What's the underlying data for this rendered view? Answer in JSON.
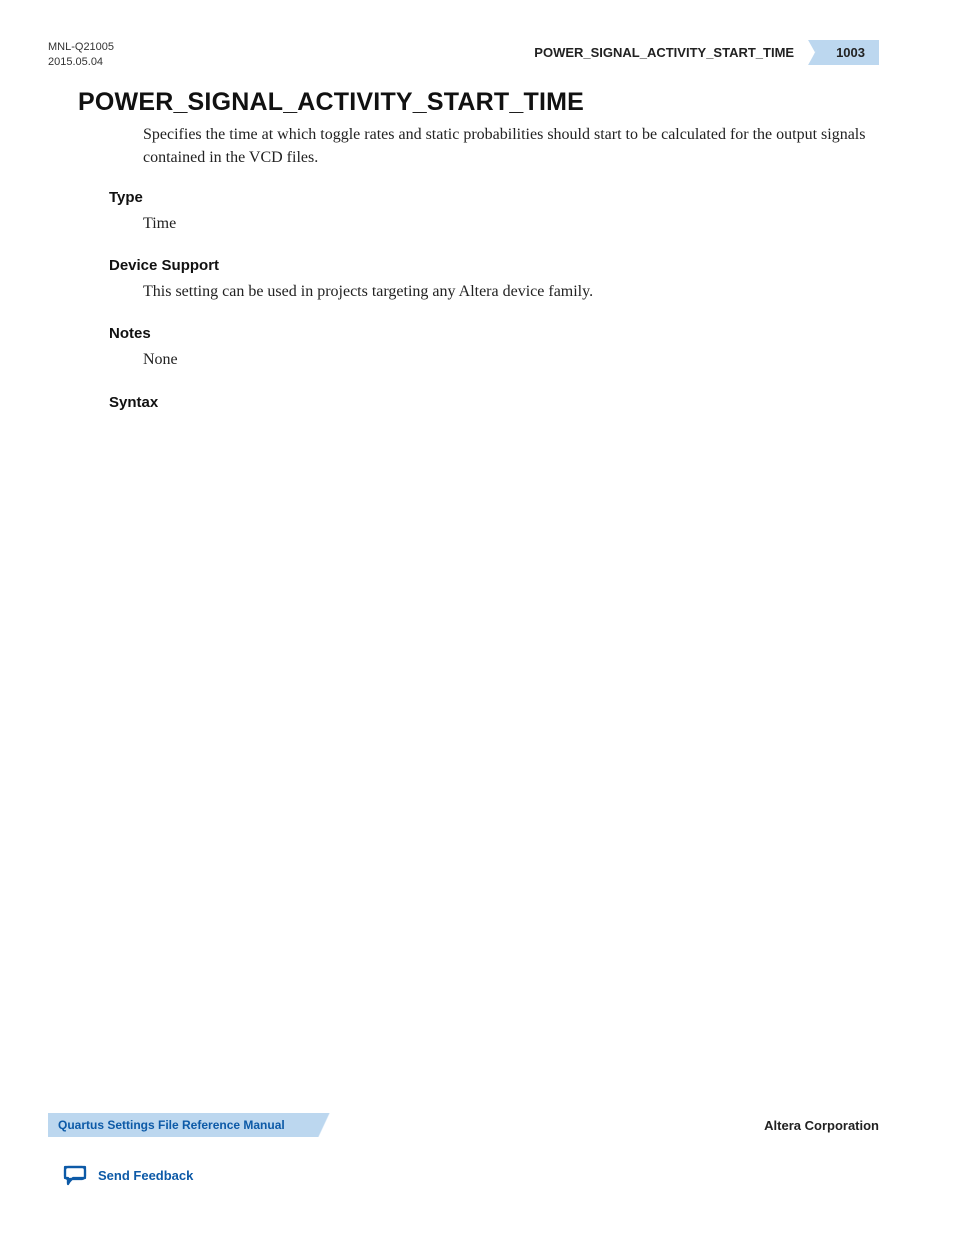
{
  "header": {
    "doc_id": "MNL-Q21005",
    "date": "2015.05.04",
    "running_title": "POWER_SIGNAL_ACTIVITY_START_TIME",
    "page_number": "1003"
  },
  "main": {
    "heading": "POWER_SIGNAL_ACTIVITY_START_TIME",
    "intro": "Specifies the time at which toggle rates and static probabilities should start to be calculated for the output signals contained in the VCD files.",
    "sections": {
      "type": {
        "label": "Type",
        "body": "Time"
      },
      "device_support": {
        "label": "Device Support",
        "body": "This setting can be used in projects targeting any Altera device family."
      },
      "notes": {
        "label": "Notes",
        "body": "None"
      },
      "syntax": {
        "label": "Syntax",
        "body": ""
      }
    }
  },
  "footer": {
    "manual_title": "Quartus Settings File Reference Manual",
    "company": "Altera Corporation",
    "feedback_label": "Send Feedback"
  }
}
